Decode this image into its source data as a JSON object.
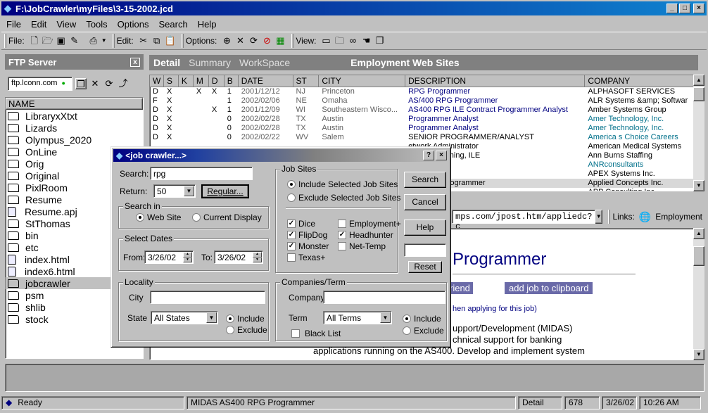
{
  "window": {
    "title": "F:\\JobCrawler\\myFiles\\3-15-2002.jcd",
    "min": "_",
    "max": "□",
    "close": "×"
  },
  "menu": [
    "File",
    "Edit",
    "View",
    "Tools",
    "Options",
    "Search",
    "Help"
  ],
  "toolbar": {
    "file_label": "File:",
    "edit_label": "Edit:",
    "options_label": "Options:",
    "view_label": "View:"
  },
  "ftp": {
    "title": "FTP Server",
    "close": "x",
    "server": "ftp.lconn.com",
    "name_header": "NAME",
    "items": [
      "LibraryxXtxt",
      "Lizards",
      "Olympus_2020",
      "OnLine",
      "Orig",
      "Original",
      "PixlRoom",
      "Resume",
      "Resume.apj",
      "StThomas",
      "bin",
      "etc",
      "index.html",
      "index6.html",
      "jobcrawler",
      "psm",
      "shlib",
      "stock"
    ]
  },
  "tabs": {
    "detail": "Detail",
    "summary": "Summary",
    "workspace": "WorkSpace",
    "heading": "Employment Web Sites"
  },
  "table": {
    "headers": [
      "W",
      "S",
      "K",
      "M",
      "D",
      "B",
      "DATE",
      "ST",
      "CITY",
      "DESCRIPTION",
      "COMPANY"
    ],
    "rows": [
      [
        "D",
        "X",
        "",
        "X",
        "X",
        "1",
        "2001/12/12",
        "NJ",
        "Princeton",
        "RPG Programmer",
        "ALPHASOFT SERVICES"
      ],
      [
        "F",
        "X",
        "",
        "",
        "",
        "1",
        "2002/02/06",
        "NE",
        "Omaha",
        "AS/400 RPG Programmer",
        "ALR Systems &amp; Softwar"
      ],
      [
        "D",
        "X",
        "",
        "",
        "X",
        "1",
        "2001/12/09",
        "WI",
        "Southeastern Wisco...",
        "AS400 RPG ILE Contract Programmer Analyst",
        "Amber Systems Group"
      ],
      [
        "D",
        "X",
        "",
        "",
        "",
        "0",
        "2002/02/28",
        "TX",
        "Austin",
        "Programmer Analyst",
        "Amer Technology, Inc."
      ],
      [
        "D",
        "X",
        "",
        "",
        "",
        "0",
        "2002/02/28",
        "TX",
        "Austin",
        "Programmer Analyst",
        "Amer Technology, Inc."
      ],
      [
        "D",
        "X",
        "",
        "",
        "",
        "0",
        "2002/02/22",
        "WV",
        "Salem",
        "SENIOR PROGRAMMER/ANALYST",
        "America s Choice Careers"
      ],
      [
        "",
        "",
        "",
        "",
        "",
        "",
        "",
        "",
        "",
        "etwork Administrator",
        "American Medical Systems"
      ],
      [
        "",
        "",
        "",
        "",
        "",
        "",
        "",
        "",
        "",
        "IV Programming, ILE",
        "Ann Burns Staffing"
      ],
      [
        "",
        "",
        "",
        "",
        "",
        "",
        "",
        "",
        "",
        "grammer",
        "ANRconsultants"
      ],
      [
        "",
        "",
        "",
        "",
        "",
        "",
        "",
        "",
        "",
        "r/Analysts",
        "APEX Systems Inc."
      ],
      [
        "",
        "",
        "",
        "",
        "",
        "",
        "",
        "",
        "",
        "400 RPG Programmer",
        "Applied Concepts Inc."
      ],
      [
        "",
        "",
        "",
        "",
        "",
        "",
        "",
        "",
        "",
        "",
        "APP Consulting Inc."
      ]
    ]
  },
  "browser": {
    "url": "mps.com/jpost.htm/appliedc?c",
    "links_label": "Links:",
    "links_item": "Employment",
    "heading": "Programmer",
    "friend_btn": "riend",
    "clip_btn": "add job to clipboard",
    "apply_note": "hen applying for this job)",
    "line1": "upport/Development (MIDAS)",
    "line2": "chnical support for banking",
    "line3": "applications running on the AS400. Develop and implement system"
  },
  "status": {
    "ready": "Ready",
    "job": "MIDAS AS400 RPG Programmer",
    "view": "Detail",
    "count": "678",
    "date": "3/26/02",
    "time": "10:26 AM"
  },
  "dialog": {
    "title": "<job crawler...>",
    "help_q": "?",
    "close": "×",
    "search_label": "Search:",
    "search_value": "rpg",
    "return_label": "Return:",
    "return_value": "50",
    "regular_btn": "Regular...",
    "search_in": "Search in",
    "web_site": "Web Site",
    "current_display": "Current Display",
    "select_dates": "Select Dates",
    "from_label": "From:",
    "from_value": "3/26/02",
    "to_label": "To:",
    "to_value": "3/26/02",
    "locality": "Locality",
    "city_label": "City",
    "city_value": "",
    "state_label": "State",
    "state_value": "All States",
    "include": "Include",
    "exclude": "Exclude",
    "job_sites": "Job Sites",
    "include_sites": "Include Selected Job Sites",
    "exclude_sites": "Exclude Selected Job Sites",
    "sites": [
      {
        "name": "Dice",
        "checked": true
      },
      {
        "name": "Employment+",
        "checked": false
      },
      {
        "name": "FlipDog",
        "checked": true
      },
      {
        "name": "Headhunter",
        "checked": true
      },
      {
        "name": "Monster",
        "checked": true
      },
      {
        "name": "Net-Temp",
        "checked": false
      },
      {
        "name": "Texas+",
        "checked": false
      }
    ],
    "companies_term": "Companies/Term",
    "company_label": "Company",
    "company_value": "",
    "term_label": "Term",
    "term_value": "All Terms",
    "black_list": "Black List",
    "btn_search": "Search",
    "btn_cancel": "Cancel",
    "btn_help": "Help",
    "btn_reset": "Reset"
  }
}
